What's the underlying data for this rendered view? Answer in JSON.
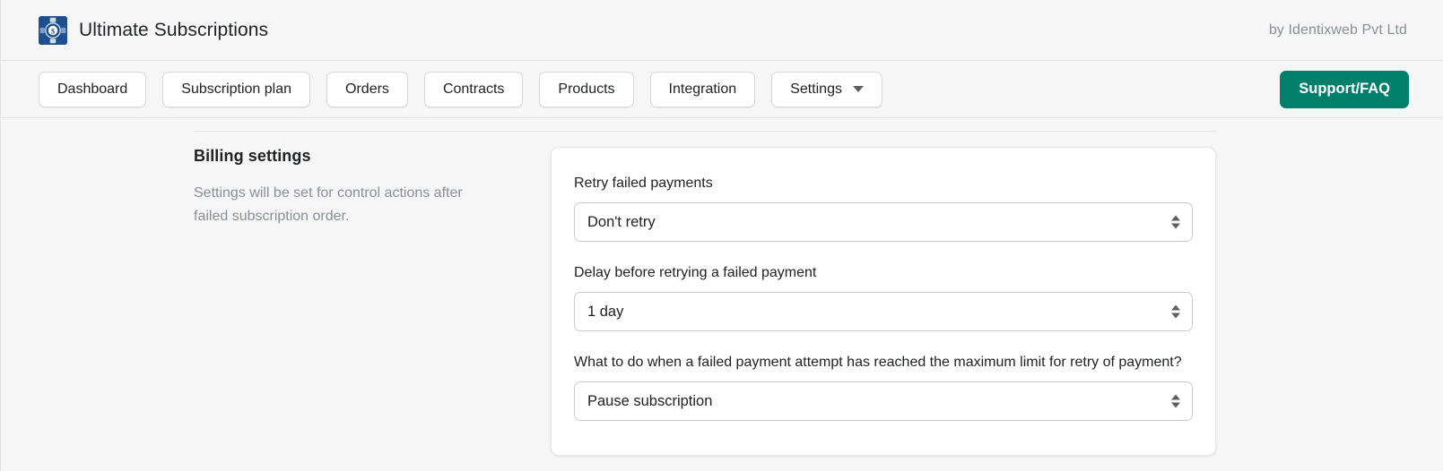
{
  "header": {
    "app_title": "Ultimate Subscriptions",
    "logo_icon": "subscription-dollar-icon",
    "byline": "by Identixweb Pvt Ltd"
  },
  "nav": {
    "items": [
      {
        "label": "Dashboard",
        "has_caret": false
      },
      {
        "label": "Subscription plan",
        "has_caret": false
      },
      {
        "label": "Orders",
        "has_caret": false
      },
      {
        "label": "Contracts",
        "has_caret": false
      },
      {
        "label": "Products",
        "has_caret": false
      },
      {
        "label": "Integration",
        "has_caret": false
      },
      {
        "label": "Settings",
        "has_caret": true
      }
    ],
    "support_label": "Support/FAQ",
    "support_color": "#00806a"
  },
  "settings": {
    "title": "Billing settings",
    "description": "Settings will be set for control actions after failed subscription order.",
    "fields": [
      {
        "label": "Retry failed payments",
        "value": "Don't retry"
      },
      {
        "label": "Delay before retrying a failed payment",
        "value": "1 day"
      },
      {
        "label": "What to do when a failed payment attempt has reached the maximum limit for retry of payment?",
        "value": "Pause subscription"
      }
    ]
  }
}
